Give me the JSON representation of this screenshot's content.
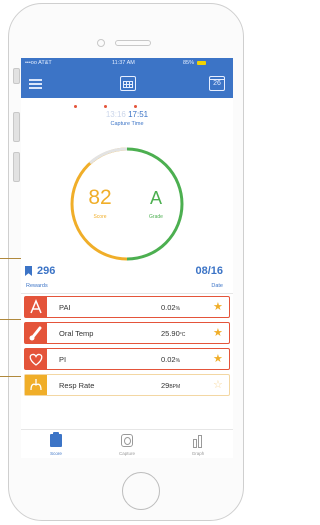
{
  "status_bar": {
    "carrier": "•••oo AT&T",
    "time": "11:37 AM",
    "battery": "85%"
  },
  "nav": {
    "calendar_day": "26"
  },
  "capture": {
    "time_faint": "13:16",
    "time": "17:51",
    "label": "Capture Time"
  },
  "score": {
    "value": "82",
    "label": "Score"
  },
  "grade": {
    "value": "A",
    "label": "Grade"
  },
  "rewards": {
    "value": "296",
    "label": "Rewards"
  },
  "date": {
    "value": "08/16",
    "label": "Date"
  },
  "metrics": [
    {
      "name": "PAI",
      "value": "0.02",
      "unit": "%"
    },
    {
      "name": "Oral Temp",
      "value": "25.90",
      "unit": "°C"
    },
    {
      "name": "PI",
      "value": "0.02",
      "unit": "%"
    },
    {
      "name": "Resp Rate",
      "value": "29",
      "unit": "BPM"
    }
  ],
  "tabs": {
    "score": "Score",
    "capture": "Capture",
    "graph": "Graph"
  },
  "colors": {
    "primary": "#3c74c6",
    "accent_red": "#e4543a",
    "accent_orange": "#f0ae29",
    "accent_green": "#4caf50"
  },
  "icons": {
    "menu": "hamburger-icon",
    "calendar": "calendar-icon",
    "rewards": "ribbon-icon",
    "pai": "pai-icon",
    "temp": "thermometer-icon",
    "pi": "heart-icon",
    "resp": "lungs-icon",
    "star": "star-icon"
  }
}
